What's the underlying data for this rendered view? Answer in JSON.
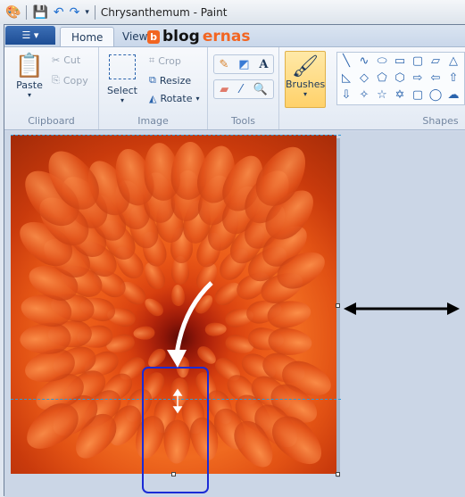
{
  "titlebar": {
    "title": "Chrysanthemum - Paint"
  },
  "tabs": {
    "app_menu": "☰ ▾",
    "home": "Home",
    "view": "View"
  },
  "watermark": {
    "b": "b",
    "blog": "blog",
    "ernas": "ernas"
  },
  "clipboard": {
    "paste": "Paste",
    "cut": "Cut",
    "copy": "Copy",
    "label": "Clipboard"
  },
  "image": {
    "select": "Select",
    "crop": "Crop",
    "resize": "Resize",
    "rotate": "Rotate",
    "label": "Image"
  },
  "tools": {
    "label": "Tools",
    "items": [
      "pencil-icon",
      "fill-icon",
      "text-icon",
      "eraser-icon",
      "color-picker-icon",
      "magnifier-icon"
    ]
  },
  "brushes": {
    "label": "Brushes"
  },
  "shapes": {
    "label": "Shapes",
    "glyphs": [
      "╲",
      "∿",
      "⬭",
      "▭",
      "▢",
      "▱",
      "△",
      "◺",
      "◇",
      "⬠",
      "⬡",
      "⇨",
      "⇦",
      "⇧",
      "⇩",
      "✧",
      "☆",
      "✡",
      "▢",
      "◯",
      "☁"
    ]
  }
}
